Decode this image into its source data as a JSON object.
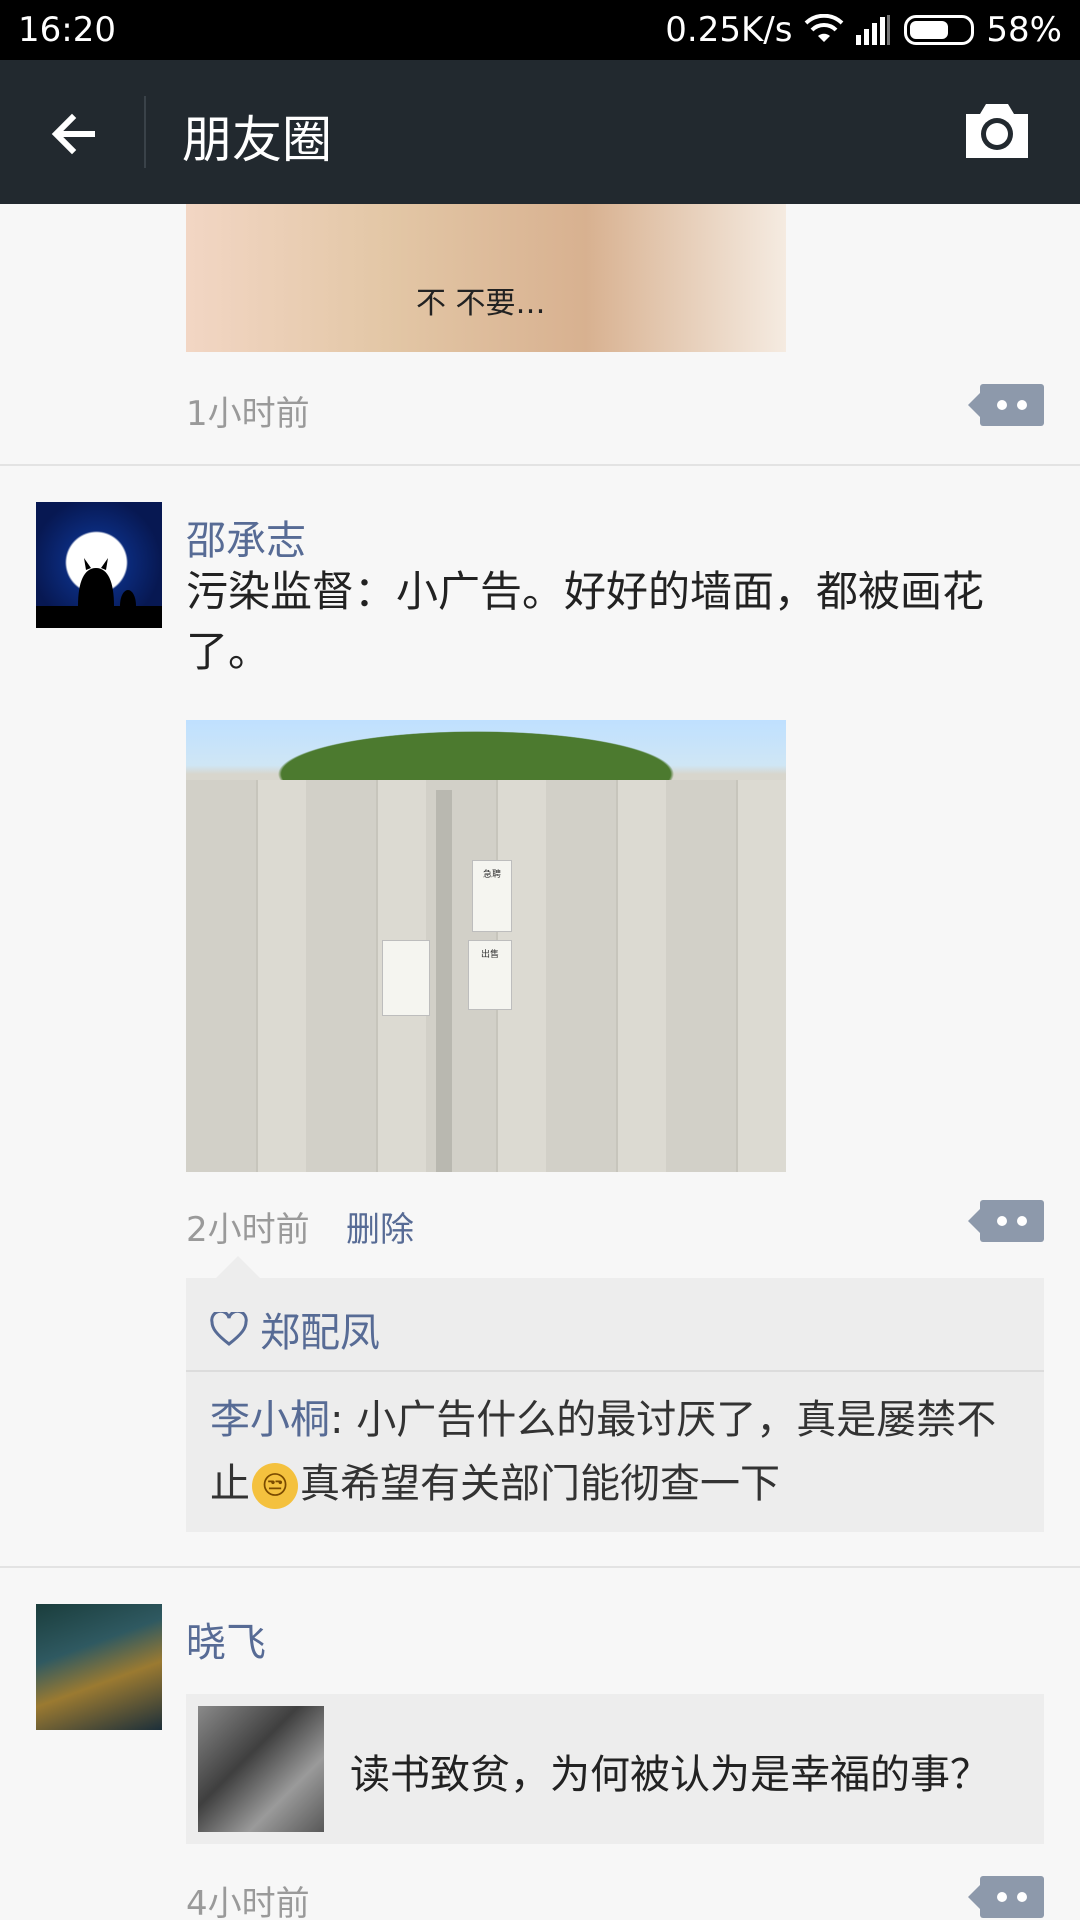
{
  "status_bar": {
    "time": "16:20",
    "speed": "0.25K/s",
    "battery_percent": "58%",
    "battery_level": 0.58
  },
  "title_bar": {
    "title": "朋友圈"
  },
  "feed": {
    "post0": {
      "photo_caption": "不 不要…",
      "time": "1小时前"
    },
    "post1": {
      "name": "邵承志",
      "text": "污染监督：小广告。好好的墙面，都被画花了。",
      "photo_notices": [
        "急聘",
        "出售"
      ],
      "time": "2小时前",
      "delete_label": "删除",
      "likes": "郑配凤",
      "comment": {
        "author": "李小桐",
        "before_emoji": ": 小广告什么的最讨厌了，真是屡禁不止",
        "emoji": "😒",
        "after_emoji": "真希望有关部门能彻查一下"
      }
    },
    "post2": {
      "name": "晓飞",
      "share_title": "读书致贫，为何被认为是幸福的事？",
      "time": "4小时前"
    }
  },
  "icons": {
    "back": "arrow-left-icon",
    "camera": "camera-icon",
    "comment": "comment-dots-icon",
    "heart": "heart-outline-icon"
  },
  "colors": {
    "titlebar": "#22292f",
    "link": "#576b95"
  }
}
